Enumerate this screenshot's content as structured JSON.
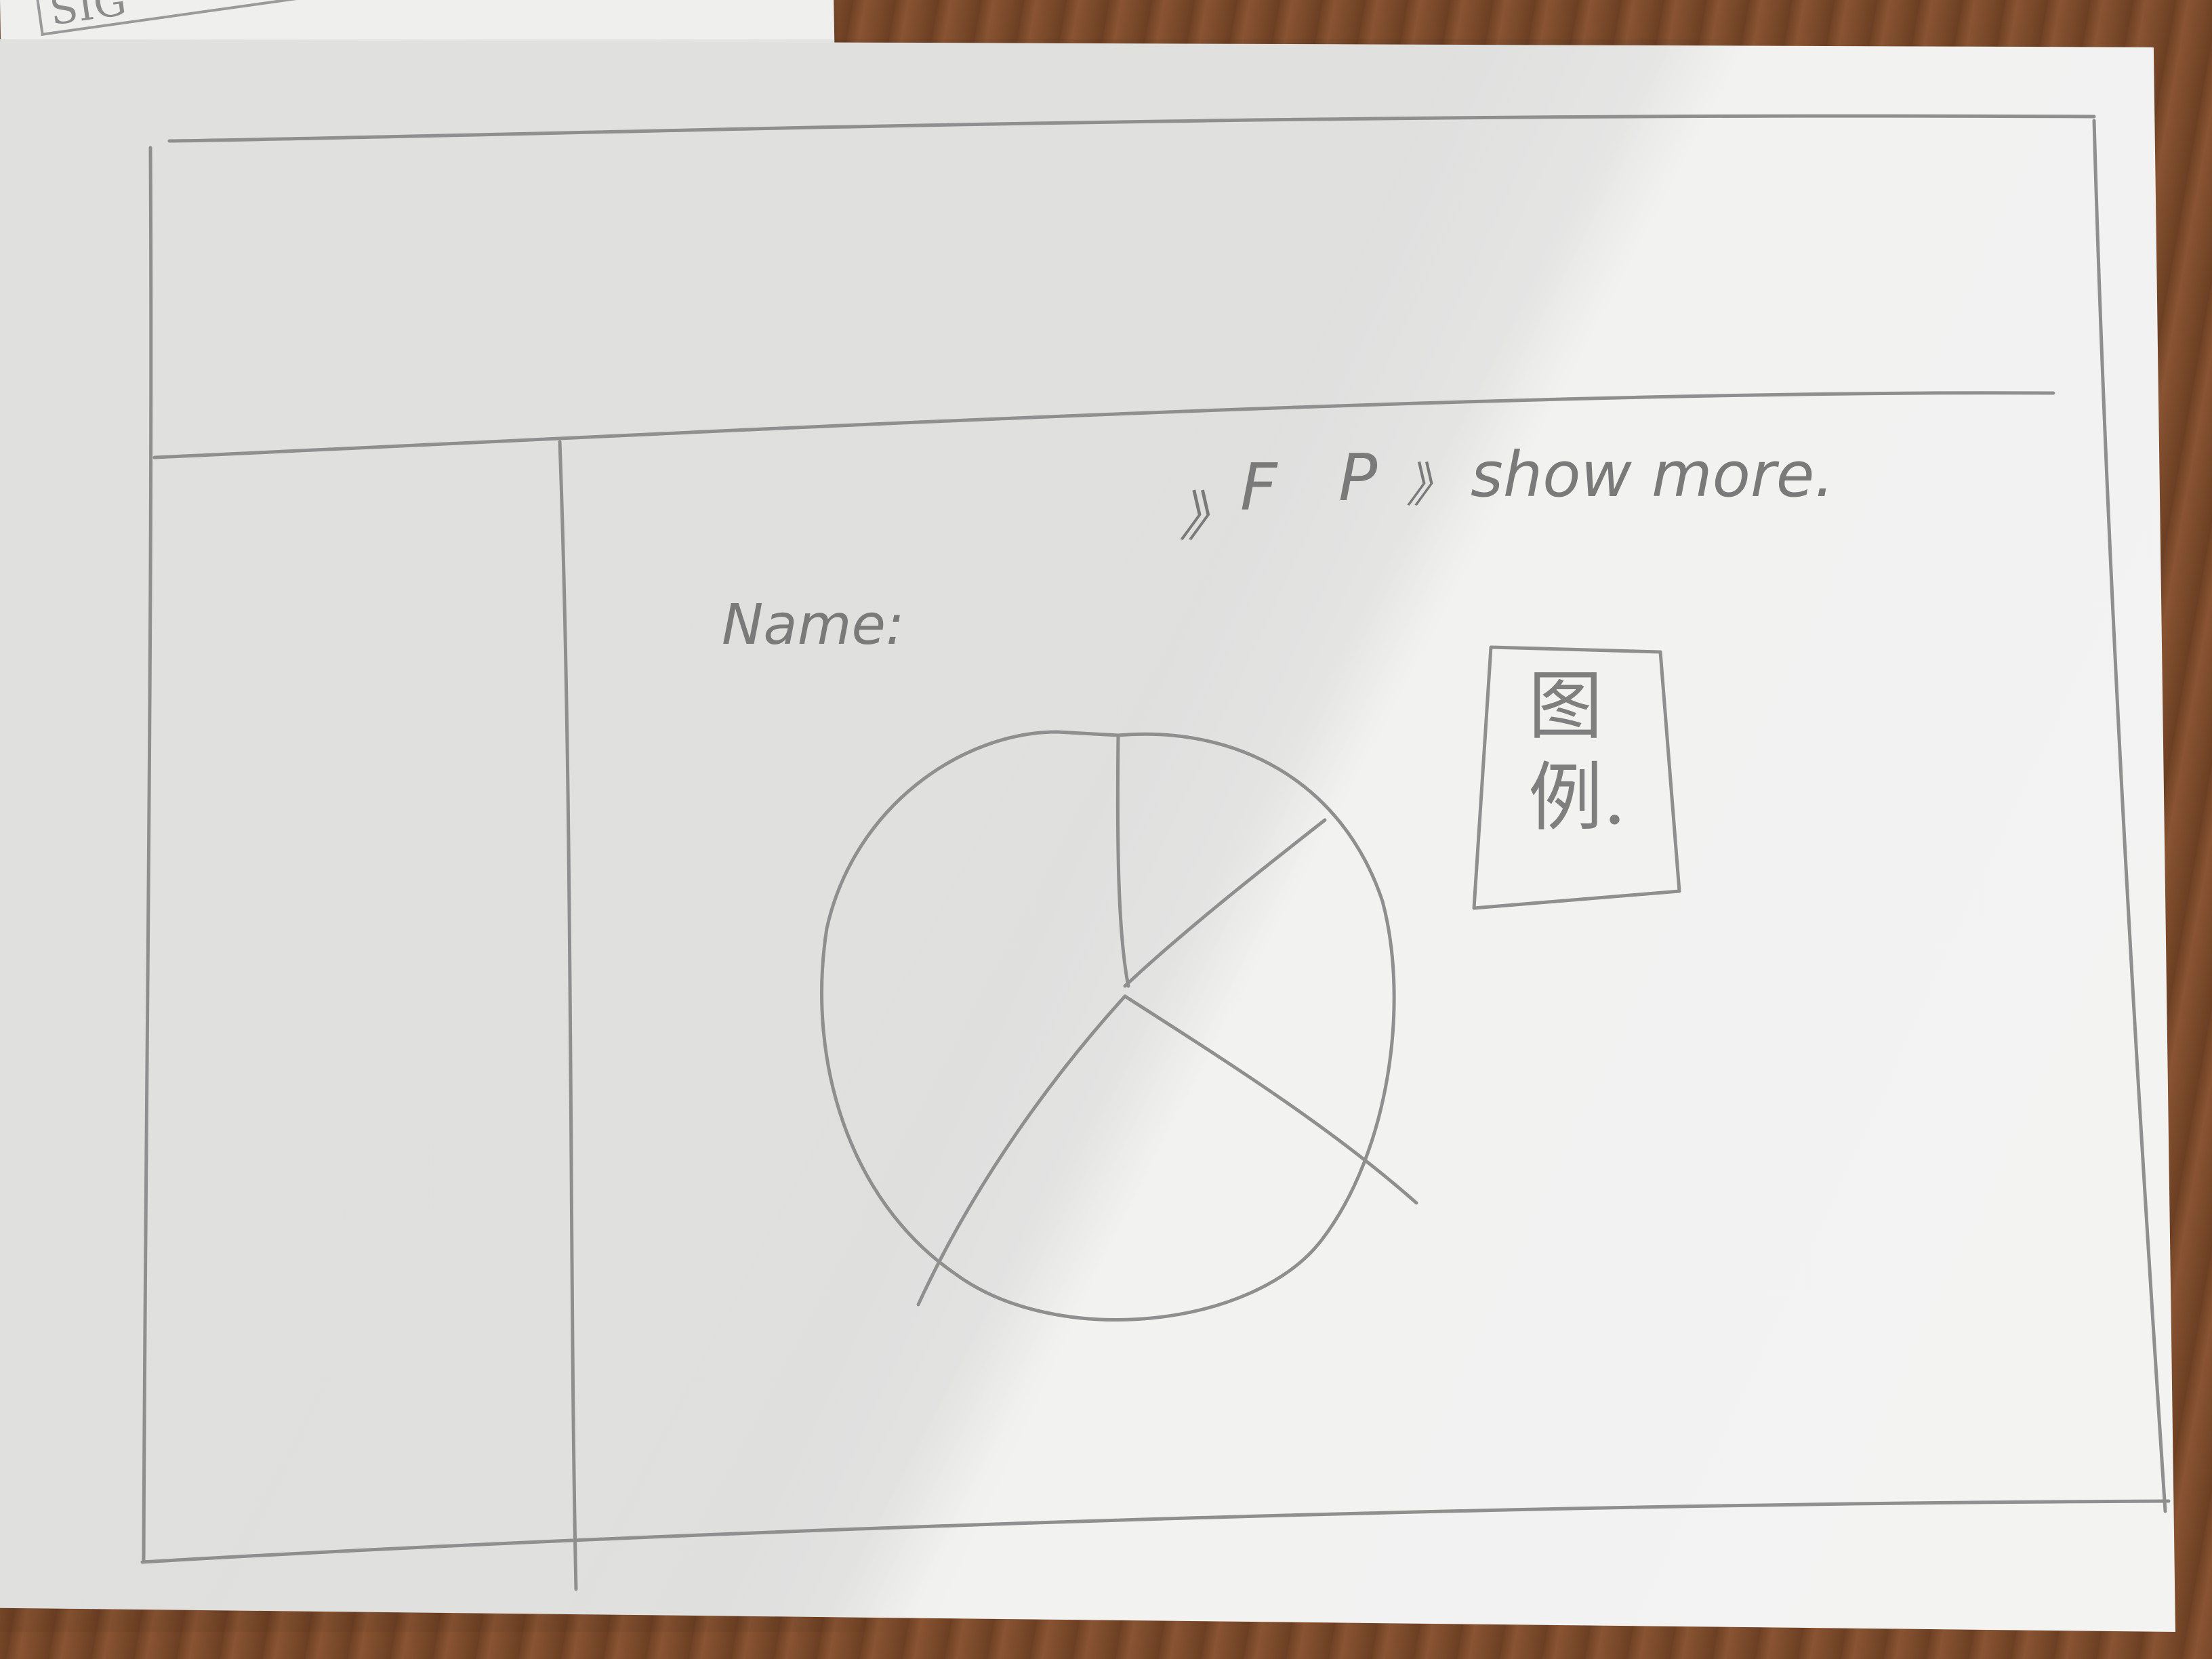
{
  "background_paper": {
    "label": "SIG"
  },
  "nav": {
    "prefix": "》",
    "item_f": "F",
    "item_p": "P",
    "more_prefix": "》",
    "show_more": "show more."
  },
  "content": {
    "name_label": "Name:"
  },
  "legend": {
    "title_line1": "图",
    "title_line2": "例."
  },
  "chart_data": {
    "type": "pie",
    "slice_count": 4,
    "note_values": [],
    "labels": []
  },
  "colors": {
    "paper": "#ebebea",
    "pencil": "#8a8a8a",
    "desk": "#7a4a2a"
  }
}
